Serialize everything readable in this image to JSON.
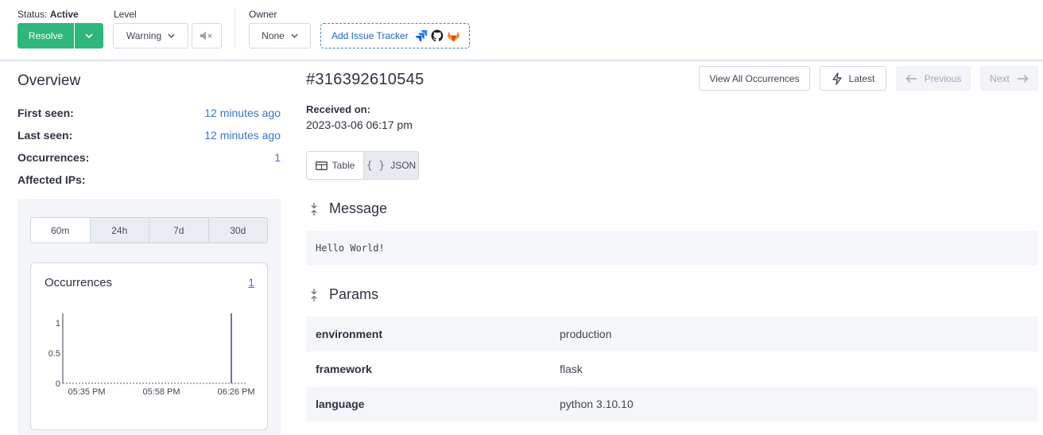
{
  "status": {
    "label": "Status:",
    "value": "Active"
  },
  "resolve_button": "Resolve",
  "level": {
    "label": "Level",
    "value": "Warning"
  },
  "owner": {
    "label": "Owner",
    "value": "None"
  },
  "add_issue_tracker": "Add Issue Tracker",
  "colors": {
    "accent_green": "#2eb67d",
    "link_blue": "#3b73d4",
    "dashed_border": "#3d7fd9"
  },
  "overview": {
    "title": "Overview",
    "stats": [
      {
        "label": "First seen:",
        "value": "12 minutes ago"
      },
      {
        "label": "Last seen:",
        "value": "12 minutes ago"
      },
      {
        "label": "Occurrences:",
        "value": "1"
      },
      {
        "label": "Affected IPs:",
        "value": ""
      }
    ],
    "time_ranges": [
      "60m",
      "24h",
      "7d",
      "30d"
    ],
    "selected_range": "60m",
    "occurrences_card": {
      "title": "Occurrences",
      "count": "1"
    }
  },
  "chart_data": {
    "type": "bar",
    "title": "",
    "xlabel": "",
    "ylabel": "",
    "yticks": [
      "0",
      "0.5",
      "1"
    ],
    "ylim": [
      0,
      1
    ],
    "xticks": [
      "05:35 PM",
      "05:58 PM",
      "06:26 PM"
    ],
    "series": [
      {
        "x": "06:26 PM",
        "value": 1
      }
    ],
    "grid": false
  },
  "occurrence": {
    "id": "#316392610545",
    "received_label": "Received on:",
    "received_value": "2023-03-06 06:17 pm",
    "toolbar": {
      "view_all": "View All Occurrences",
      "latest": "Latest",
      "previous": "Previous",
      "next": "Next"
    },
    "view_toggle": {
      "table": "Table",
      "json": "JSON"
    },
    "message_heading": "Message",
    "message_text": "Hello World!",
    "params_heading": "Params",
    "params": [
      {
        "key": "environment",
        "value": "production"
      },
      {
        "key": "framework",
        "value": "flask"
      },
      {
        "key": "language",
        "value": "python 3.10.10"
      }
    ]
  }
}
